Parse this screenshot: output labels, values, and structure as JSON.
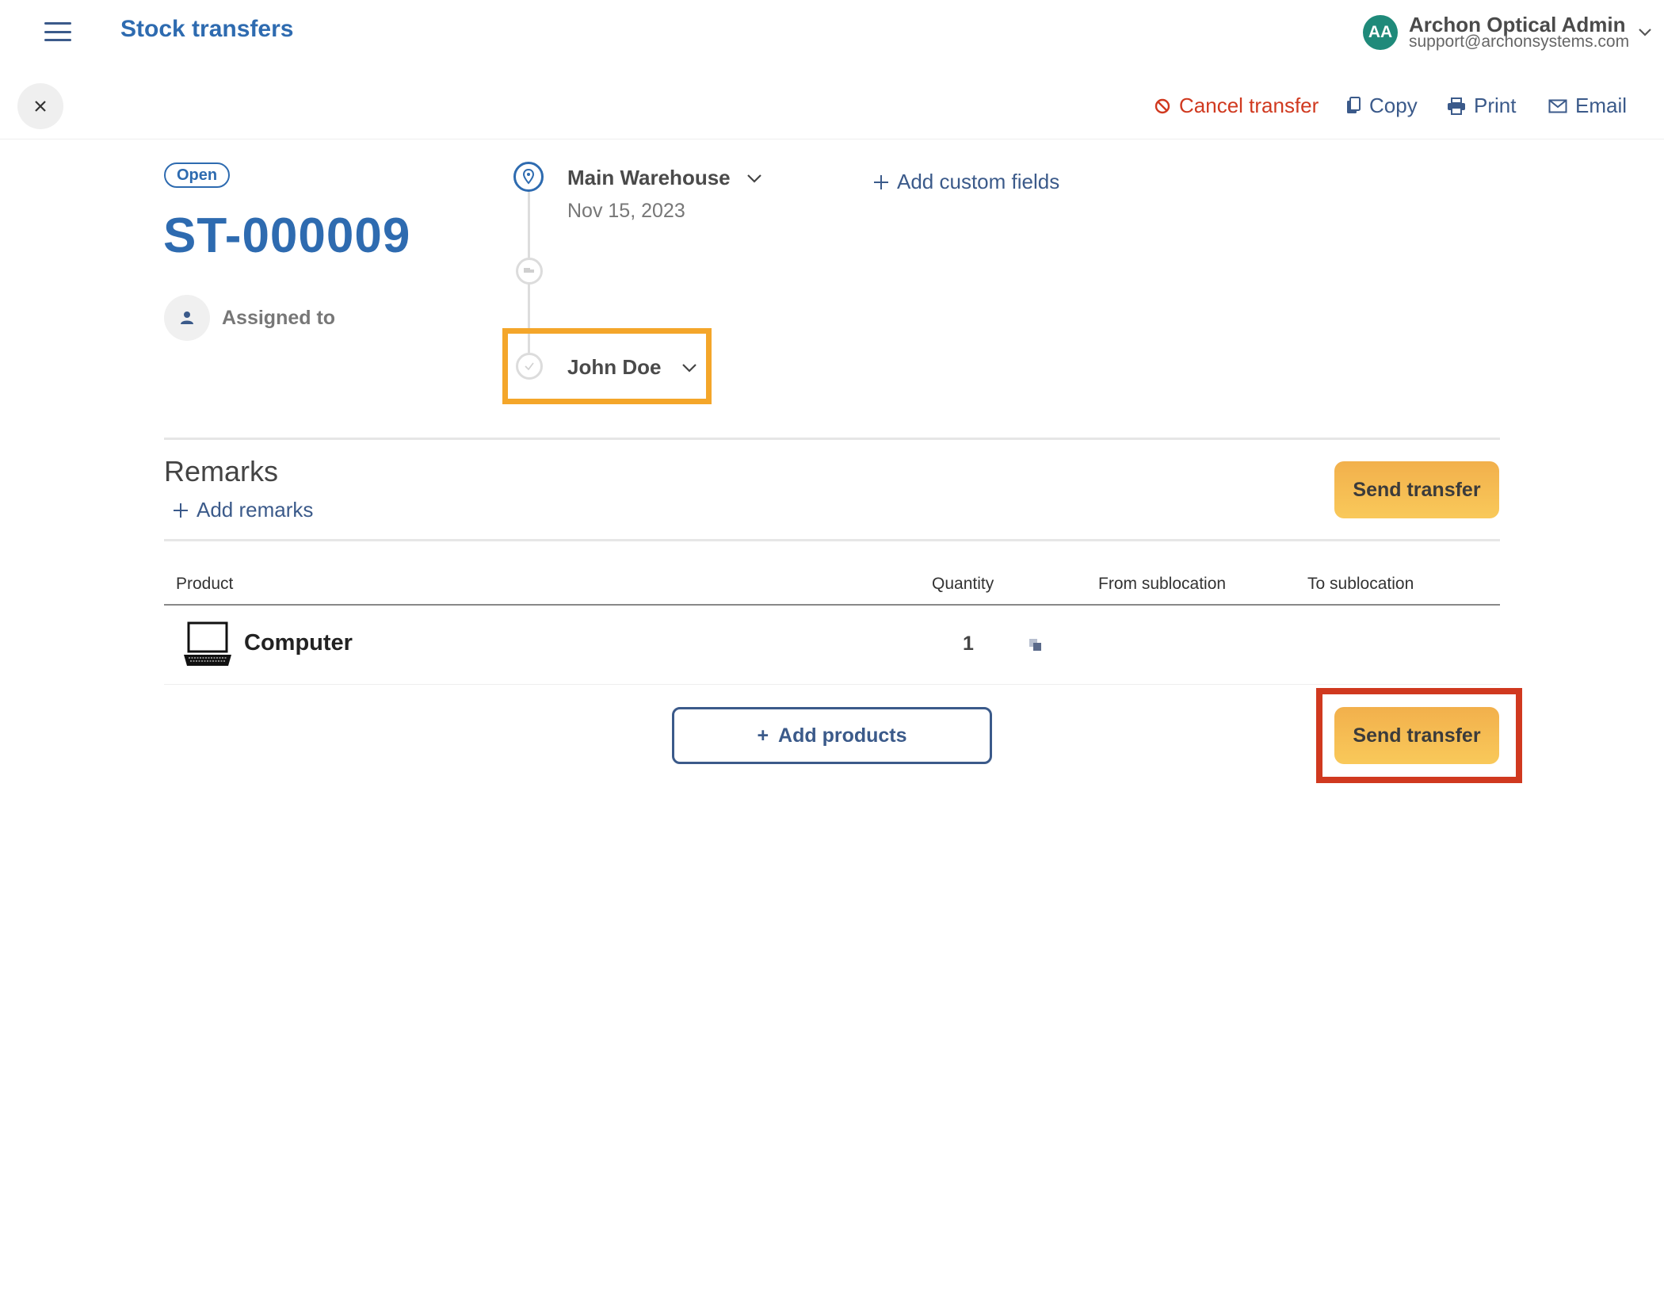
{
  "header": {
    "title": "Stock transfers",
    "user": {
      "initials": "AA",
      "name": "Archon Optical Admin",
      "email": "support@archonsystems.com"
    }
  },
  "toolbar": {
    "cancel_label": "Cancel transfer",
    "copy_label": "Copy",
    "print_label": "Print",
    "email_label": "Email"
  },
  "transfer": {
    "status": "Open",
    "number": "ST-000009",
    "assigned_label": "Assigned to",
    "from_location": "Main Warehouse",
    "date": "Nov 15, 2023",
    "to_location": "John Doe",
    "custom_fields_label": "Add custom fields"
  },
  "remarks": {
    "title": "Remarks",
    "add_label": "Add remarks"
  },
  "actions": {
    "send_label": "Send transfer",
    "add_products_label": "Add products"
  },
  "table": {
    "headers": [
      "Product",
      "Quantity",
      "From sublocation",
      "To sublocation"
    ],
    "rows": [
      {
        "product": "Computer",
        "quantity": "1",
        "from": "",
        "to": ""
      }
    ]
  },
  "colors": {
    "brand_blue": "#2e6bb0",
    "danger_red": "#d0391f",
    "primary_button": "#f6bd52",
    "highlight_orange": "#f4a62a",
    "highlight_red": "#d0391f"
  }
}
